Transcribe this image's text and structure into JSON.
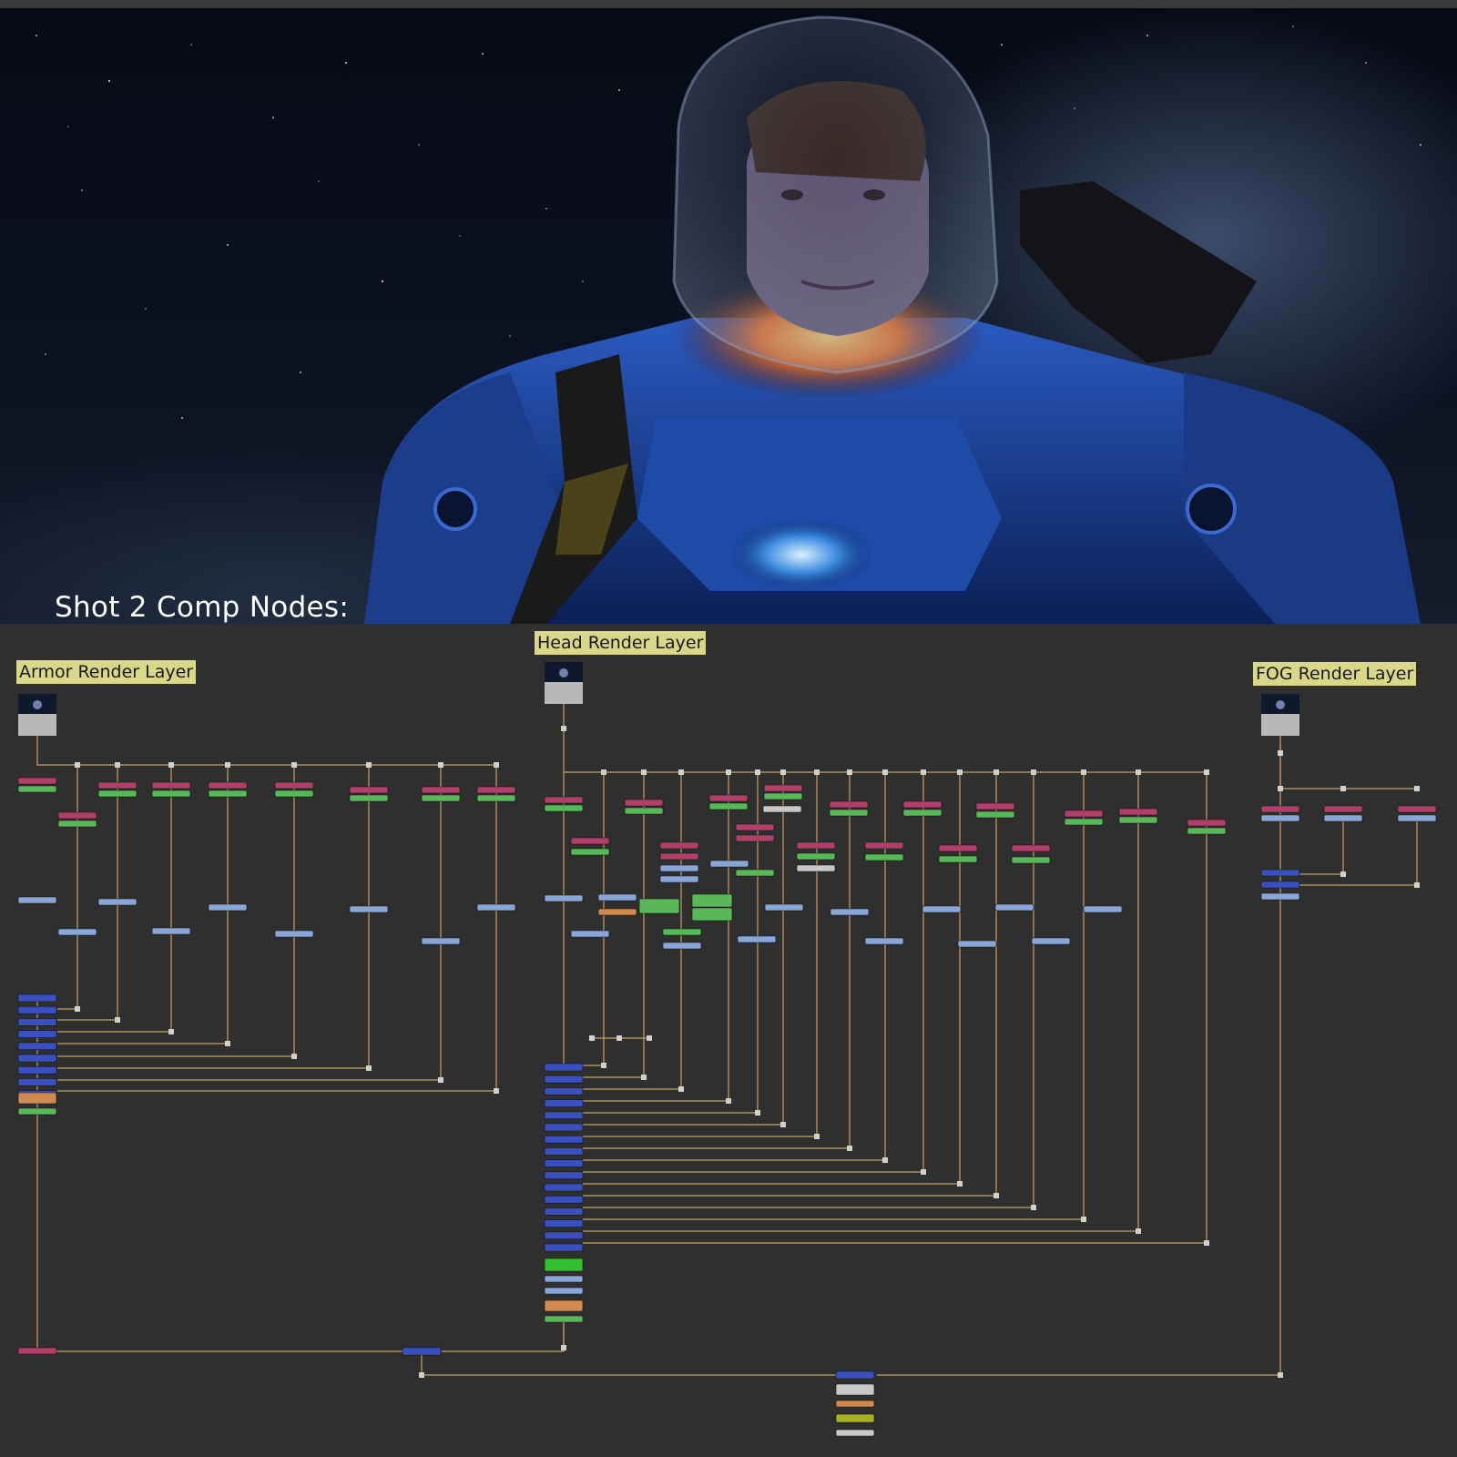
{
  "viewer": {
    "title": "Shot 2 Comp Nodes:"
  },
  "node_graph": {
    "backdrops": [
      {
        "id": "armor",
        "label": "Armor Render Layer"
      },
      {
        "id": "head",
        "label": "Head Render Layer"
      },
      {
        "id": "fog",
        "label": "FOG Render Layer"
      }
    ],
    "colors": {
      "graph_background": "#2f2f2f",
      "wire": "#c8a060",
      "grade_node": "#b0406a",
      "color_node": "#58b858",
      "shuffle_node": "#8aa6d8",
      "merge_node": "#3a50c0",
      "backdrop_label": "#d9d78a",
      "orange_node": "#d08a50",
      "yellow_node": "#a8b020"
    }
  }
}
